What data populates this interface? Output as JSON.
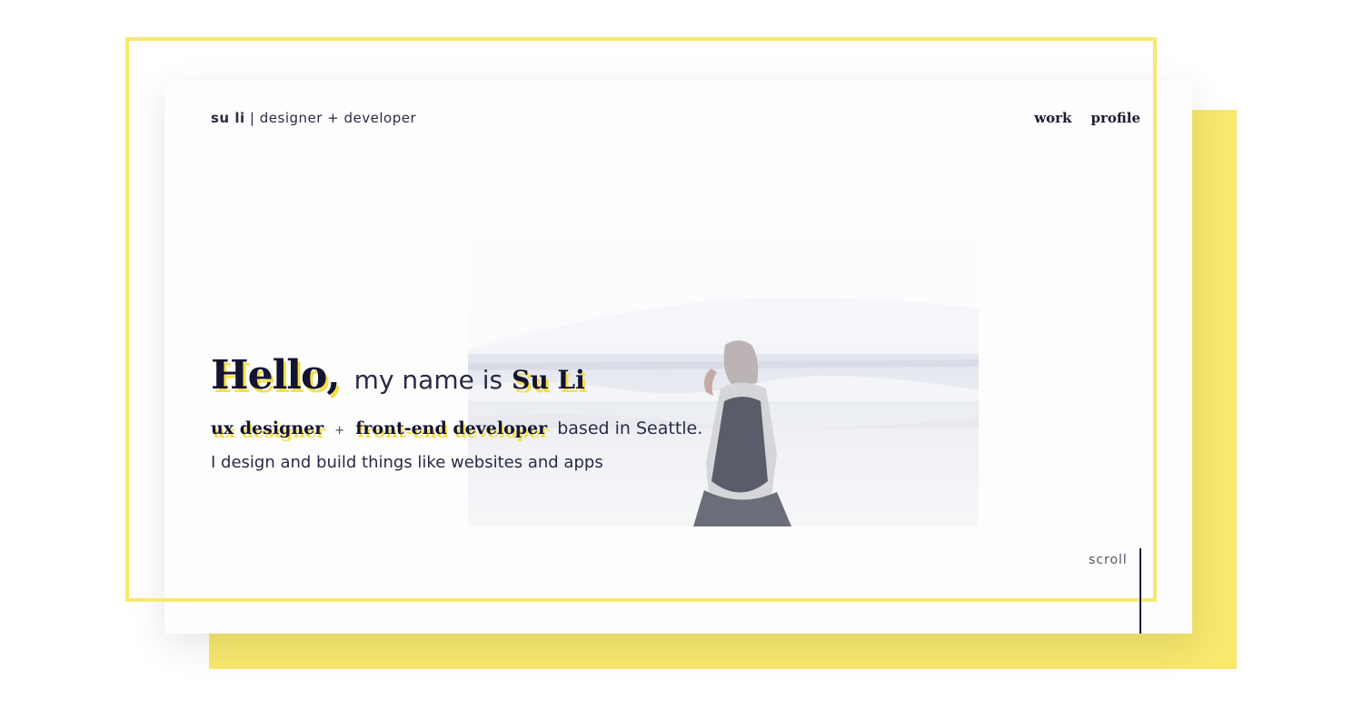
{
  "header": {
    "brand_name": "su li",
    "brand_separator": "|",
    "brand_tagline": "designer + developer",
    "nav": [
      {
        "label": "work"
      },
      {
        "label": "profile"
      }
    ]
  },
  "hero": {
    "greeting": "Hello,",
    "intro": "my name is",
    "name": "Su Li",
    "role1": "ux designer",
    "plus": "+",
    "role2": "front-end developer",
    "location": "based in Seattle.",
    "description": "I design and build things like websites and apps"
  },
  "scroll": {
    "label": "scroll"
  },
  "colors": {
    "accent_yellow": "#f7e86e",
    "text_dark": "#1c1c33",
    "card": "#fdfdfd"
  }
}
